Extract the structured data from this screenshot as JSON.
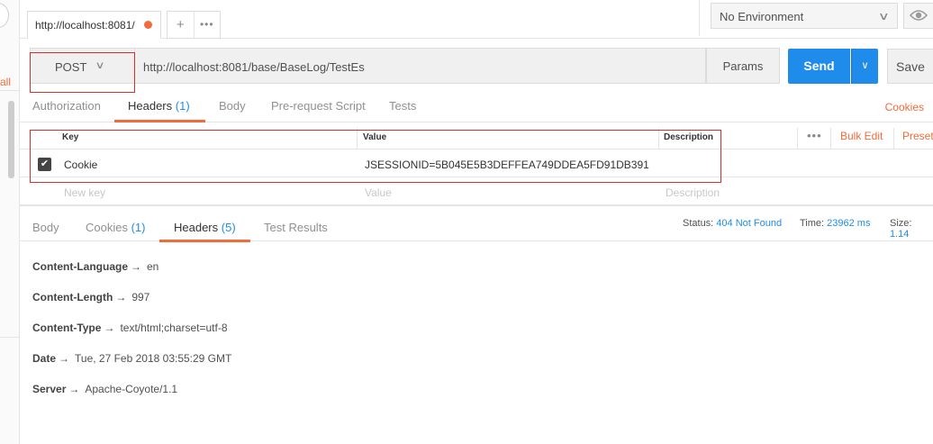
{
  "left_panel": {
    "link_fragment": "all"
  },
  "tab": {
    "title": "http://localhost:8081/",
    "add_icon": "+",
    "more_icon": "•••"
  },
  "environment": {
    "selected": "No Environment"
  },
  "request": {
    "method": "POST",
    "url": "http://localhost:8081/base/BaseLog/TestEs",
    "params_label": "Params",
    "send_label": "Send",
    "save_label": "Save"
  },
  "request_tabs": [
    {
      "label": "Authorization"
    },
    {
      "label": "Headers",
      "count": "(1)"
    },
    {
      "label": "Body"
    },
    {
      "label": "Pre-request Script"
    },
    {
      "label": "Tests"
    }
  ],
  "cookies_link": "Cookies",
  "headers_table": {
    "columns": [
      "Key",
      "Value",
      "Description"
    ],
    "bulk_edit": "Bulk Edit",
    "presets": "Presets",
    "rows": [
      {
        "checked": true,
        "key": "Cookie",
        "value": "JSESSIONID=5B045E5B3DEFFEA749DDEA5FD91DB391",
        "description": ""
      }
    ],
    "new_row": {
      "key_placeholder": "New key",
      "value_placeholder": "Value",
      "description_placeholder": "Description"
    }
  },
  "response_tabs": [
    {
      "label": "Body"
    },
    {
      "label": "Cookies",
      "count": "(1)"
    },
    {
      "label": "Headers",
      "count": "(5)"
    },
    {
      "label": "Test Results"
    }
  ],
  "response_status": {
    "status_label": "Status:",
    "status_value": "404 Not Found",
    "time_label": "Time:",
    "time_value": "23962 ms",
    "size_label": "Size:",
    "size_value": "1.14"
  },
  "response_headers": [
    {
      "key": "Content-Language",
      "value": "en"
    },
    {
      "key": "Content-Length",
      "value": "997"
    },
    {
      "key": "Content-Type",
      "value": "text/html;charset=utf-8"
    },
    {
      "key": "Date",
      "value": "Tue, 27 Feb 2018 03:55:29 GMT"
    },
    {
      "key": "Server",
      "value": "Apache-Coyote/1.1"
    }
  ],
  "colors": {
    "accent": "#f26b3a",
    "primary": "#1f8ceb",
    "highlight_box": "#d62d2d"
  }
}
